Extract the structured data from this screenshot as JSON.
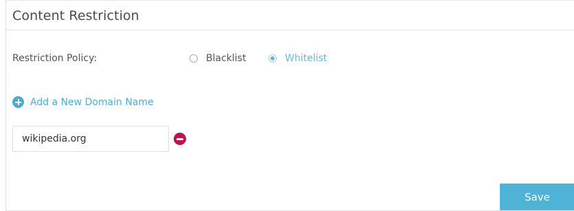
{
  "section": {
    "title": "Content Restriction"
  },
  "policy": {
    "label": "Restriction Policy:",
    "options": [
      {
        "label": "Blacklist",
        "selected": false
      },
      {
        "label": "Whitelist",
        "selected": true
      }
    ]
  },
  "domains": {
    "add_label": "Add a New Domain Name",
    "entries": [
      {
        "value": "wikipedia.org"
      }
    ]
  },
  "actions": {
    "save_label": "Save"
  },
  "colors": {
    "accent": "#4fb3d7",
    "link": "#4aaed3",
    "remove": "#b8164c"
  },
  "icons": {
    "add": "plus-circle-icon",
    "remove": "minus-circle-icon"
  }
}
